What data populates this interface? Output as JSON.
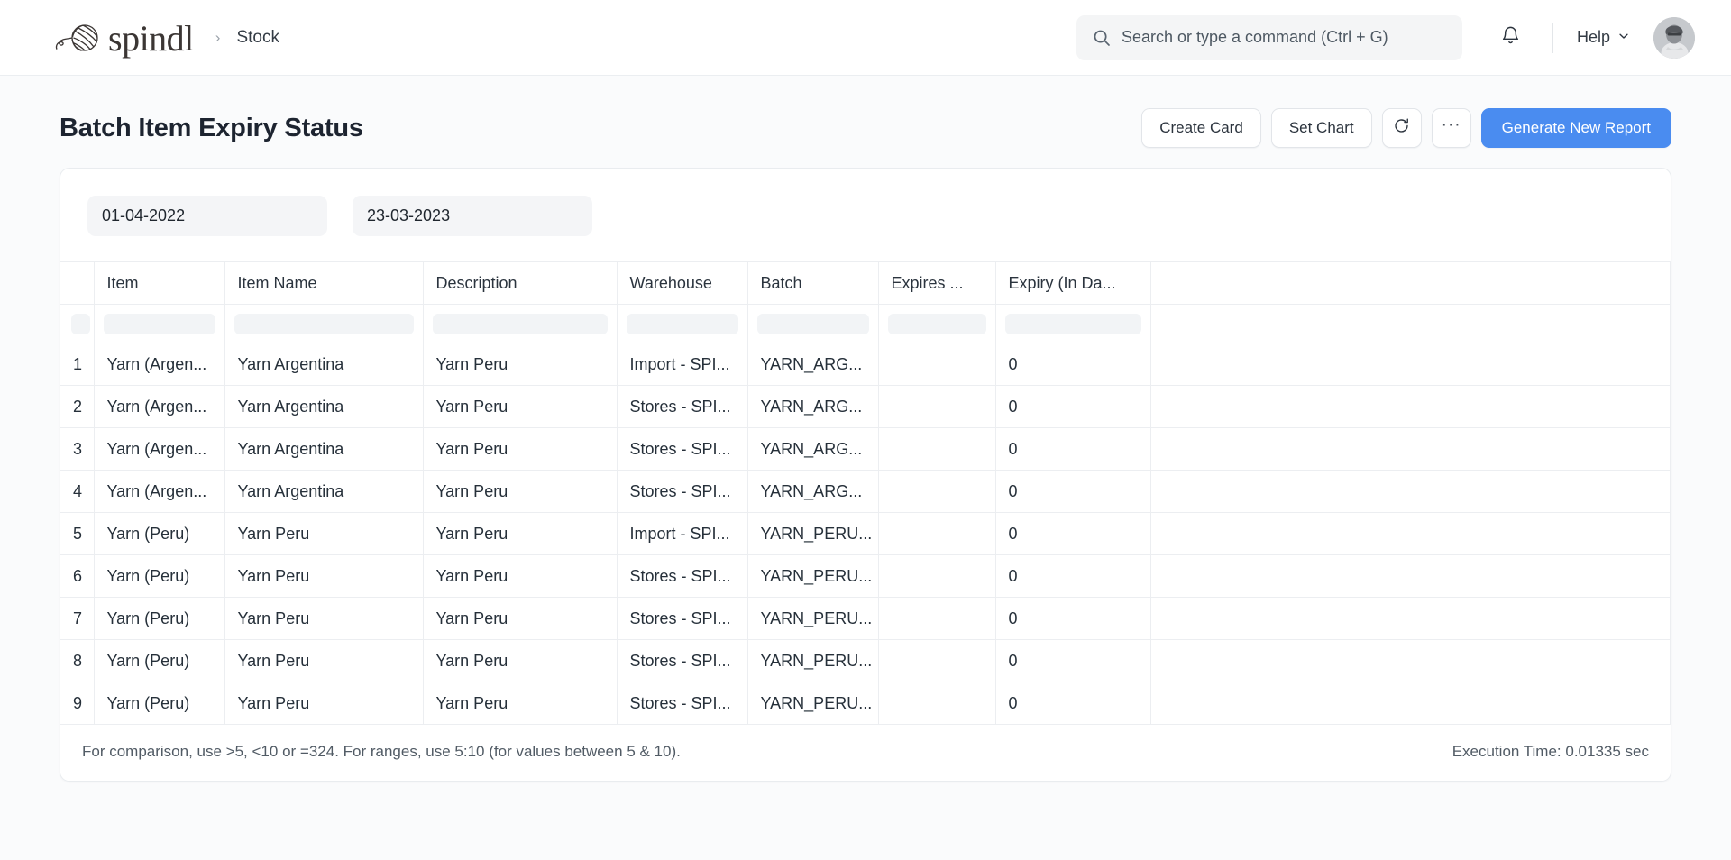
{
  "navbar": {
    "brand": "spindl",
    "breadcrumb_separator": "›",
    "breadcrumb": "Stock",
    "search_placeholder": "Search or type a command (Ctrl + G)",
    "help_label": "Help",
    "icons": {
      "search": "search-icon",
      "bell": "bell-icon",
      "chevron": "chevron-down-icon",
      "avatar": "user-avatar"
    }
  },
  "page": {
    "title": "Batch Item Expiry Status",
    "actions": {
      "create_card": "Create Card",
      "set_chart": "Set Chart",
      "refresh": "refresh-icon",
      "more": "···",
      "generate": "Generate New Report"
    }
  },
  "filters": {
    "from_date": "01-04-2022",
    "to_date": "23-03-2023"
  },
  "table": {
    "columns": [
      "Item",
      "Item Name",
      "Description",
      "Warehouse",
      "Batch",
      "Expires ...",
      "Expiry (In Da..."
    ],
    "rows": [
      {
        "idx": "1",
        "item": "Yarn (Argen...",
        "item_name": "Yarn Argentina",
        "description": "Yarn Peru",
        "warehouse": "Import - SPI...",
        "batch": "YARN_ARG...",
        "expires": "",
        "expiry_days": "0"
      },
      {
        "idx": "2",
        "item": "Yarn (Argen...",
        "item_name": "Yarn Argentina",
        "description": "Yarn Peru",
        "warehouse": "Stores - SPI...",
        "batch": "YARN_ARG...",
        "expires": "",
        "expiry_days": "0"
      },
      {
        "idx": "3",
        "item": "Yarn (Argen...",
        "item_name": "Yarn Argentina",
        "description": "Yarn Peru",
        "warehouse": "Stores - SPI...",
        "batch": "YARN_ARG...",
        "expires": "",
        "expiry_days": "0"
      },
      {
        "idx": "4",
        "item": "Yarn (Argen...",
        "item_name": "Yarn Argentina",
        "description": "Yarn Peru",
        "warehouse": "Stores - SPI...",
        "batch": "YARN_ARG...",
        "expires": "",
        "expiry_days": "0"
      },
      {
        "idx": "5",
        "item": "Yarn (Peru)",
        "item_name": "Yarn Peru",
        "description": "Yarn Peru",
        "warehouse": "Import - SPI...",
        "batch": "YARN_PERU...",
        "expires": "",
        "expiry_days": "0"
      },
      {
        "idx": "6",
        "item": "Yarn (Peru)",
        "item_name": "Yarn Peru",
        "description": "Yarn Peru",
        "warehouse": "Stores - SPI...",
        "batch": "YARN_PERU...",
        "expires": "",
        "expiry_days": "0"
      },
      {
        "idx": "7",
        "item": "Yarn (Peru)",
        "item_name": "Yarn Peru",
        "description": "Yarn Peru",
        "warehouse": "Stores - SPI...",
        "batch": "YARN_PERU...",
        "expires": "",
        "expiry_days": "0"
      },
      {
        "idx": "8",
        "item": "Yarn (Peru)",
        "item_name": "Yarn Peru",
        "description": "Yarn Peru",
        "warehouse": "Stores - SPI...",
        "batch": "YARN_PERU...",
        "expires": "",
        "expiry_days": "0"
      },
      {
        "idx": "9",
        "item": "Yarn (Peru)",
        "item_name": "Yarn Peru",
        "description": "Yarn Peru",
        "warehouse": "Stores - SPI...",
        "batch": "YARN_PERU...",
        "expires": "",
        "expiry_days": "0"
      }
    ]
  },
  "footer": {
    "hint": "For comparison, use >5, <10 or =324. For ranges, use 5:10 (for values between 5 & 10).",
    "execution_time": "Execution Time: 0.01335 sec"
  },
  "colors": {
    "primary": "#4a8cf0",
    "page_bg": "#fafbfc",
    "text": "#26303a"
  }
}
